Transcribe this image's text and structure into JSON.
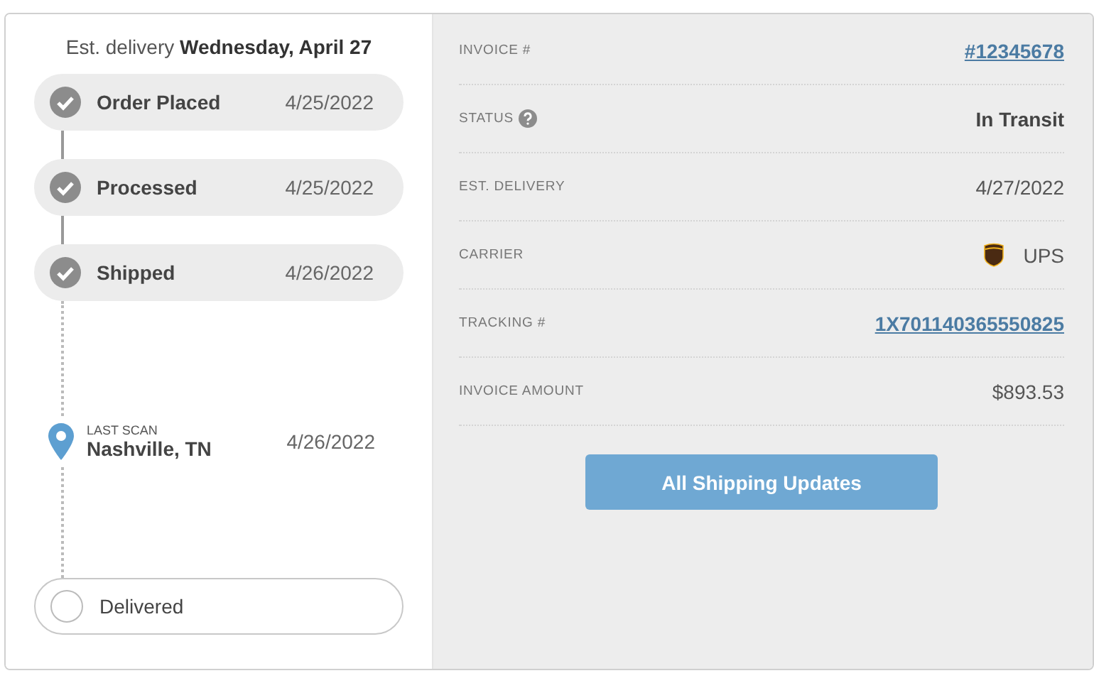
{
  "estimate": "Est. delivery **Wednesday, April 27**",
  "steps": [
    {
      "kind": "done",
      "label": "Order Placed",
      "date": "4/25/2022"
    },
    {
      "kind": "done",
      "label": "Processed",
      "date": "4/25/2022"
    },
    {
      "kind": "done",
      "label": "Shipped",
      "date": "4/26/2022"
    },
    {
      "kind": "scan",
      "caption": "LAST SCAN",
      "label": "Nashville, TN",
      "date": "4/26/2022"
    },
    {
      "kind": "pending",
      "label": "Delivered"
    }
  ],
  "details": [
    {
      "label": "INVOICE #",
      "kind": "link",
      "value": "#12345678"
    },
    {
      "label": "STATUS",
      "help": true,
      "kind": "strong",
      "value": "In Transit"
    },
    {
      "label": "EST. DELIVERY",
      "kind": "text",
      "value": "4/27/2022"
    },
    {
      "label": "CARRIER",
      "kind": "carrier",
      "value": "UPS"
    },
    {
      "label": "TRACKING #",
      "kind": "link",
      "value": "1X701140365550825"
    },
    {
      "label": "INVOICE AMOUNT",
      "kind": "text",
      "value": "$893.53"
    }
  ],
  "button": "All Shipping Updates"
}
